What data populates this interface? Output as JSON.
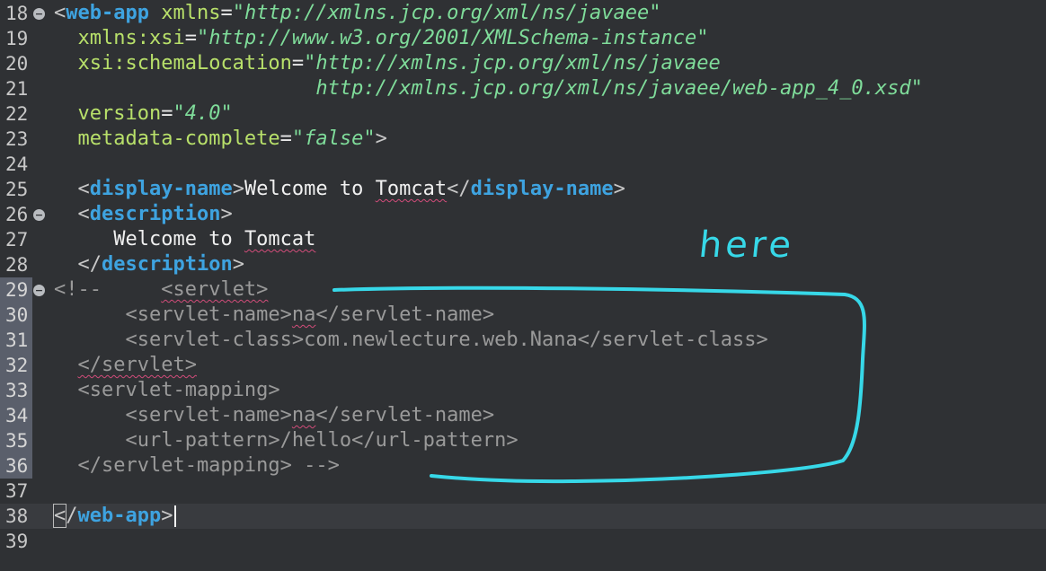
{
  "editor": {
    "lines": [
      {
        "num": "18",
        "fold": true,
        "html": "<span class='br'>&lt;</span><span class='tag'>web-app</span> <span class='attr'>xmlns</span><span class='eq'>=</span><span class='str'>\"http://xmlns.jcp.org/xml/ns/javaee\"</span>"
      },
      {
        "num": "19",
        "html": "  <span class='attr'>xmlns:xsi</span><span class='eq'>=</span><span class='str'>\"http://www.w3.org/2001/XMLSchema-instance\"</span>"
      },
      {
        "num": "20",
        "html": "  <span class='attr'>xsi:schemaLocation</span><span class='eq'>=</span><span class='str'>\"http://xmlns.jcp.org/xml/ns/javaee</span>"
      },
      {
        "num": "21",
        "html": "                      <span class='str'>http://xmlns.jcp.org/xml/ns/javaee/web-app_4_0.xsd\"</span>"
      },
      {
        "num": "22",
        "html": "  <span class='attr'>version</span><span class='eq'>=</span><span class='str'>\"4.0\"</span>"
      },
      {
        "num": "23",
        "html": "  <span class='attr'>metadata-complete</span><span class='eq'>=</span><span class='str'>\"false\"</span><span class='br'>&gt;</span>"
      },
      {
        "num": "24",
        "html": ""
      },
      {
        "num": "25",
        "html": "  <span class='br'>&lt;</span><span class='tag'>display-name</span><span class='br'>&gt;</span><span class='txt'>Welcome to <span class='squig'>Tomcat</span></span><span class='br'>&lt;/</span><span class='tag'>display-name</span><span class='br'>&gt;</span>"
      },
      {
        "num": "26",
        "fold": true,
        "html": "  <span class='br'>&lt;</span><span class='tag'>description</span><span class='br'>&gt;</span>"
      },
      {
        "num": "27",
        "html": "     <span class='txt'>Welcome to <span class='squig'>Tomcat</span></span>"
      },
      {
        "num": "28",
        "html": "  <span class='br'>&lt;/</span><span class='tag'>description</span><span class='br'>&gt;</span>"
      },
      {
        "num": "29",
        "fold": true,
        "sel": true,
        "html": "<span class='cmt'>&lt;!--     <span class='squig'>&lt;servlet&gt;</span></span>"
      },
      {
        "num": "30",
        "sel": true,
        "html": "<span class='cmt'>      &lt;servlet-name&gt;<span class='squig'>na</span>&lt;/servlet-name&gt;</span>"
      },
      {
        "num": "31",
        "sel": true,
        "html": "<span class='cmt'>      &lt;servlet-class&gt;com.newlecture.web.Nana&lt;/servlet-class&gt;</span>"
      },
      {
        "num": "32",
        "sel": true,
        "html": "<span class='cmt'>  <span class='squig'>&lt;/servlet&gt;</span></span>"
      },
      {
        "num": "33",
        "sel": true,
        "html": "<span class='cmt'>  &lt;servlet-mapping&gt;</span>"
      },
      {
        "num": "34",
        "sel": true,
        "html": "<span class='cmt'>      &lt;servlet-name&gt;<span class='squig'>na</span>&lt;/servlet-name&gt;</span>"
      },
      {
        "num": "35",
        "sel": true,
        "html": "<span class='cmt'>      &lt;url-pattern&gt;/hello&lt;/url-pattern&gt;</span>"
      },
      {
        "num": "36",
        "sel": true,
        "html": "<span class='cmt'>  &lt;/servlet-mapping&gt; --&gt;</span>"
      },
      {
        "num": "37",
        "html": ""
      },
      {
        "num": "38",
        "current": true,
        "html": "<span class='br caret-box'>&lt;</span><span class='br'>/</span><span class='tag'>web-app</span><span class='br'>&gt;</span><span class='caret'></span>"
      },
      {
        "num": "39",
        "html": ""
      }
    ]
  },
  "annotation": {
    "label": "here",
    "color": "#37d8e8"
  }
}
